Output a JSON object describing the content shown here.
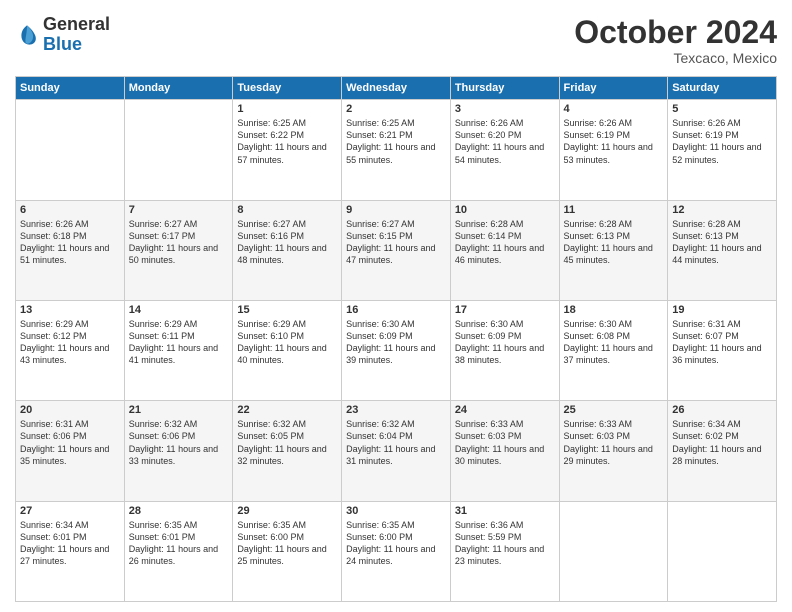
{
  "header": {
    "logo": {
      "general": "General",
      "blue": "Blue"
    },
    "title": "October 2024",
    "location": "Texcaco, Mexico"
  },
  "weekdays": [
    "Sunday",
    "Monday",
    "Tuesday",
    "Wednesday",
    "Thursday",
    "Friday",
    "Saturday"
  ],
  "weeks": [
    [
      {
        "day": "",
        "info": ""
      },
      {
        "day": "",
        "info": ""
      },
      {
        "day": "1",
        "info": "Sunrise: 6:25 AM\nSunset: 6:22 PM\nDaylight: 11 hours and 57 minutes."
      },
      {
        "day": "2",
        "info": "Sunrise: 6:25 AM\nSunset: 6:21 PM\nDaylight: 11 hours and 55 minutes."
      },
      {
        "day": "3",
        "info": "Sunrise: 6:26 AM\nSunset: 6:20 PM\nDaylight: 11 hours and 54 minutes."
      },
      {
        "day": "4",
        "info": "Sunrise: 6:26 AM\nSunset: 6:19 PM\nDaylight: 11 hours and 53 minutes."
      },
      {
        "day": "5",
        "info": "Sunrise: 6:26 AM\nSunset: 6:19 PM\nDaylight: 11 hours and 52 minutes."
      }
    ],
    [
      {
        "day": "6",
        "info": "Sunrise: 6:26 AM\nSunset: 6:18 PM\nDaylight: 11 hours and 51 minutes."
      },
      {
        "day": "7",
        "info": "Sunrise: 6:27 AM\nSunset: 6:17 PM\nDaylight: 11 hours and 50 minutes."
      },
      {
        "day": "8",
        "info": "Sunrise: 6:27 AM\nSunset: 6:16 PM\nDaylight: 11 hours and 48 minutes."
      },
      {
        "day": "9",
        "info": "Sunrise: 6:27 AM\nSunset: 6:15 PM\nDaylight: 11 hours and 47 minutes."
      },
      {
        "day": "10",
        "info": "Sunrise: 6:28 AM\nSunset: 6:14 PM\nDaylight: 11 hours and 46 minutes."
      },
      {
        "day": "11",
        "info": "Sunrise: 6:28 AM\nSunset: 6:13 PM\nDaylight: 11 hours and 45 minutes."
      },
      {
        "day": "12",
        "info": "Sunrise: 6:28 AM\nSunset: 6:13 PM\nDaylight: 11 hours and 44 minutes."
      }
    ],
    [
      {
        "day": "13",
        "info": "Sunrise: 6:29 AM\nSunset: 6:12 PM\nDaylight: 11 hours and 43 minutes."
      },
      {
        "day": "14",
        "info": "Sunrise: 6:29 AM\nSunset: 6:11 PM\nDaylight: 11 hours and 41 minutes."
      },
      {
        "day": "15",
        "info": "Sunrise: 6:29 AM\nSunset: 6:10 PM\nDaylight: 11 hours and 40 minutes."
      },
      {
        "day": "16",
        "info": "Sunrise: 6:30 AM\nSunset: 6:09 PM\nDaylight: 11 hours and 39 minutes."
      },
      {
        "day": "17",
        "info": "Sunrise: 6:30 AM\nSunset: 6:09 PM\nDaylight: 11 hours and 38 minutes."
      },
      {
        "day": "18",
        "info": "Sunrise: 6:30 AM\nSunset: 6:08 PM\nDaylight: 11 hours and 37 minutes."
      },
      {
        "day": "19",
        "info": "Sunrise: 6:31 AM\nSunset: 6:07 PM\nDaylight: 11 hours and 36 minutes."
      }
    ],
    [
      {
        "day": "20",
        "info": "Sunrise: 6:31 AM\nSunset: 6:06 PM\nDaylight: 11 hours and 35 minutes."
      },
      {
        "day": "21",
        "info": "Sunrise: 6:32 AM\nSunset: 6:06 PM\nDaylight: 11 hours and 33 minutes."
      },
      {
        "day": "22",
        "info": "Sunrise: 6:32 AM\nSunset: 6:05 PM\nDaylight: 11 hours and 32 minutes."
      },
      {
        "day": "23",
        "info": "Sunrise: 6:32 AM\nSunset: 6:04 PM\nDaylight: 11 hours and 31 minutes."
      },
      {
        "day": "24",
        "info": "Sunrise: 6:33 AM\nSunset: 6:03 PM\nDaylight: 11 hours and 30 minutes."
      },
      {
        "day": "25",
        "info": "Sunrise: 6:33 AM\nSunset: 6:03 PM\nDaylight: 11 hours and 29 minutes."
      },
      {
        "day": "26",
        "info": "Sunrise: 6:34 AM\nSunset: 6:02 PM\nDaylight: 11 hours and 28 minutes."
      }
    ],
    [
      {
        "day": "27",
        "info": "Sunrise: 6:34 AM\nSunset: 6:01 PM\nDaylight: 11 hours and 27 minutes."
      },
      {
        "day": "28",
        "info": "Sunrise: 6:35 AM\nSunset: 6:01 PM\nDaylight: 11 hours and 26 minutes."
      },
      {
        "day": "29",
        "info": "Sunrise: 6:35 AM\nSunset: 6:00 PM\nDaylight: 11 hours and 25 minutes."
      },
      {
        "day": "30",
        "info": "Sunrise: 6:35 AM\nSunset: 6:00 PM\nDaylight: 11 hours and 24 minutes."
      },
      {
        "day": "31",
        "info": "Sunrise: 6:36 AM\nSunset: 5:59 PM\nDaylight: 11 hours and 23 minutes."
      },
      {
        "day": "",
        "info": ""
      },
      {
        "day": "",
        "info": ""
      }
    ]
  ]
}
